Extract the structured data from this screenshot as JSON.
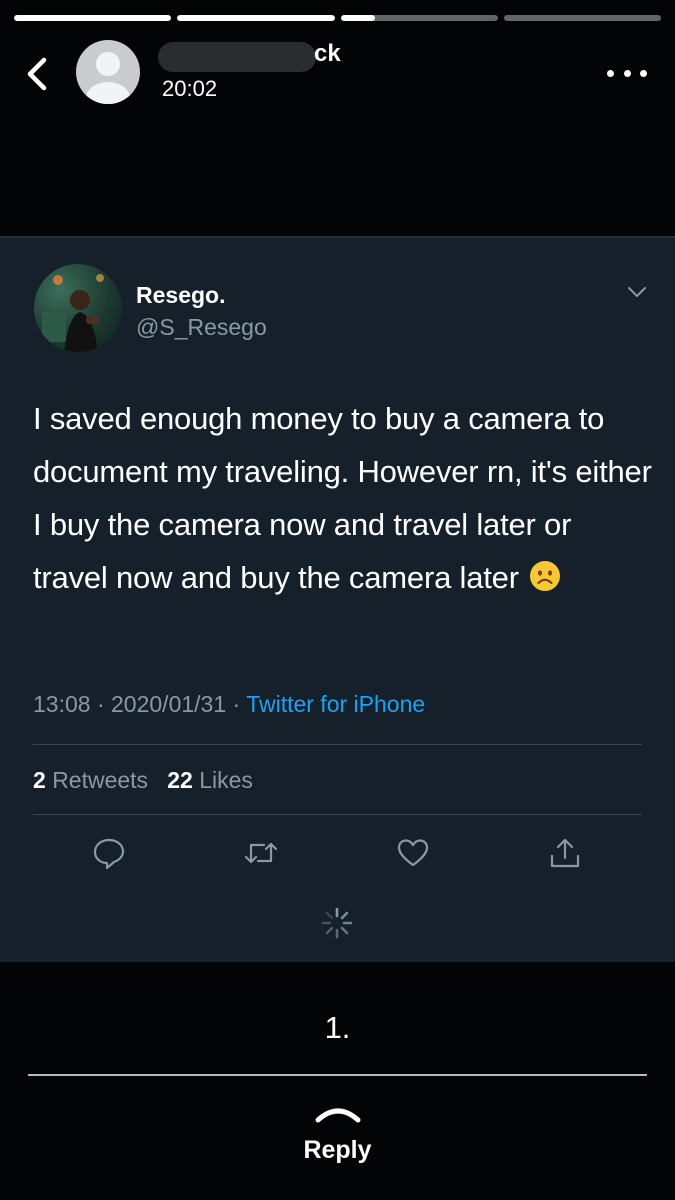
{
  "story": {
    "progress": [
      1.0,
      1.0,
      0.22,
      0.0
    ],
    "username_visible_suffix": "ck",
    "time": "20:02"
  },
  "tweet": {
    "display_name": "Resego.",
    "handle": "@S_Resego",
    "text": "I saved enough money to buy a camera to document my traveling. However rn, it's either I buy the camera now and travel later or travel now and buy the camera later",
    "emoji": "frowning-face",
    "time": "13:08",
    "date": "2020/01/31",
    "separator": "·",
    "source": "Twitter for iPhone",
    "retweets_count": "2",
    "retweets_label": "Retweets",
    "likes_count": "22",
    "likes_label": "Likes"
  },
  "colors": {
    "card_bg": "#15202b",
    "secondary_text": "#8899a6",
    "link": "#1da1f2",
    "divider": "#38444d"
  },
  "caption": "1.",
  "reply": {
    "label": "Reply"
  },
  "icons": [
    "back-chevron-icon",
    "more-dots-icon",
    "caret-down-icon",
    "reply-bubble-icon",
    "retweet-icon",
    "heart-icon",
    "share-icon",
    "loading-spinner-icon",
    "reply-up-arrow-icon"
  ]
}
